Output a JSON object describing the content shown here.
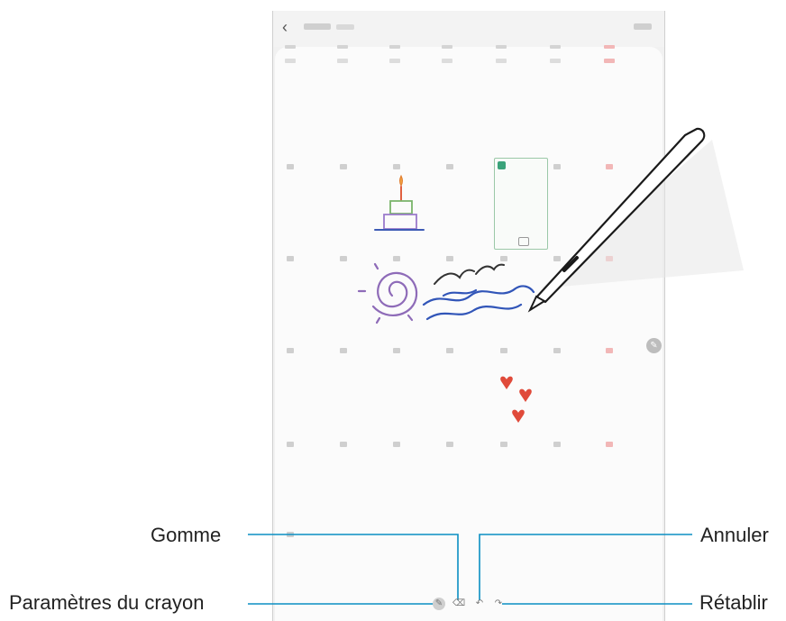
{
  "callouts": {
    "eraser": "Gomme",
    "pen_settings": "Paramètres du crayon",
    "undo": "Annuler",
    "redo": "Rétablir"
  },
  "toolbar": {
    "pen_settings_icon": "pen-settings-icon",
    "eraser_icon": "eraser-icon",
    "undo_icon": "undo-icon",
    "redo_icon": "redo-icon"
  },
  "colors": {
    "callout_line": "#0b8fc3",
    "sunday": "#f2b7b7",
    "sticky": "#3aa37a"
  }
}
